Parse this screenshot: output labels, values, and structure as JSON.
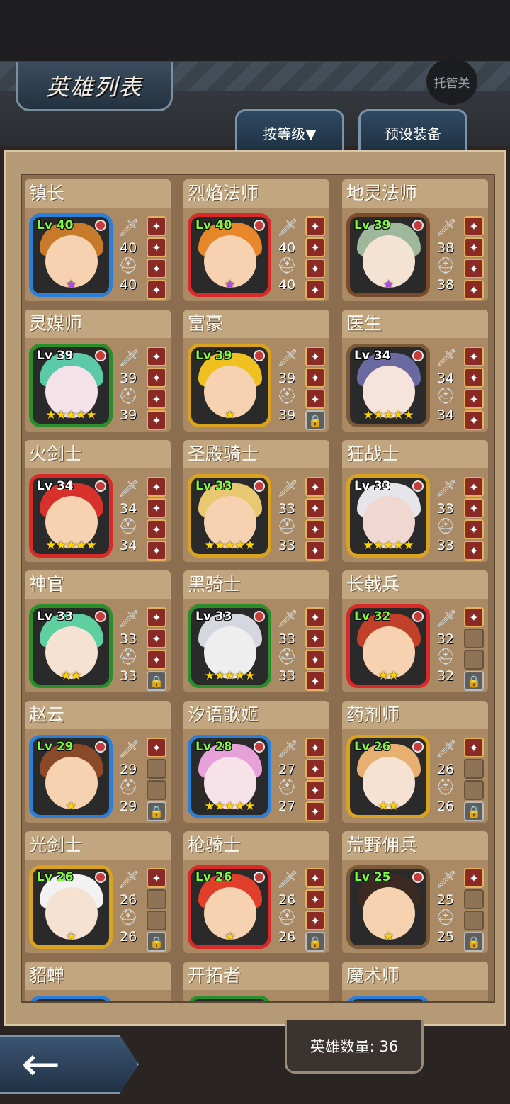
{
  "header": {
    "title": "英雄列表",
    "auto_label": "托管关"
  },
  "tabs": {
    "sort_label": "按等级▼",
    "preset_label": "预设装备"
  },
  "heroes": [
    {
      "name": "镇长",
      "level": "Lv 40",
      "atk": "40",
      "def": "40",
      "stars": 1,
      "star_color": "#c040ff",
      "frame": "#2c7fd8",
      "lvl_color": "#7cff3a",
      "hair": "#c77a2a",
      "face": "#f6d2b0",
      "slots": [
        "eq",
        "eq",
        "eq",
        "eq"
      ]
    },
    {
      "name": "烈焰法师",
      "level": "Lv 40",
      "atk": "40",
      "def": "40",
      "stars": 1,
      "star_color": "#c040ff",
      "frame": "#d92a2a",
      "lvl_color": "#7cff3a",
      "hair": "#e8862a",
      "face": "#f6d2b0",
      "slots": [
        "eq",
        "eq",
        "eq",
        "eq"
      ]
    },
    {
      "name": "地灵法师",
      "level": "Lv 39",
      "atk": "38",
      "def": "38",
      "stars": 1,
      "star_color": "#c040ff",
      "frame": "#7b4a2a",
      "lvl_color": "#7cff3a",
      "hair": "#9fb79a",
      "face": "#f4e2d2",
      "slots": [
        "eq",
        "eq",
        "eq",
        "eq"
      ]
    },
    {
      "name": "灵媒师",
      "level": "Lv 39",
      "atk": "39",
      "def": "39",
      "stars": 5,
      "star_color": "#ffd400",
      "frame": "#2a8f2a",
      "lvl_color": "#ffffff",
      "hair": "#5cc9a8",
      "face": "#f4e2e8",
      "slots": [
        "eq",
        "eq",
        "eq",
        "eq"
      ]
    },
    {
      "name": "富豪",
      "level": "Lv 39",
      "atk": "39",
      "def": "39",
      "stars": 1,
      "star_color": "#ffd400",
      "frame": "#d9a21f",
      "lvl_color": "#7cff3a",
      "hair": "#f0c020",
      "face": "#f6d2b0",
      "slots": [
        "eq",
        "eq",
        "eq",
        "lock"
      ]
    },
    {
      "name": "医生",
      "level": "Lv 34",
      "atk": "34",
      "def": "34",
      "stars": 5,
      "star_color": "#ffd400",
      "frame": "#7b5a3a",
      "lvl_color": "#ffffff",
      "hair": "#6a6aa0",
      "face": "#f6e4dc",
      "slots": [
        "eq",
        "eq",
        "eq",
        "eq"
      ]
    },
    {
      "name": "火剑士",
      "level": "Lv 34",
      "atk": "34",
      "def": "34",
      "stars": 5,
      "star_color": "#ffd400",
      "frame": "#d92a2a",
      "lvl_color": "#ffffff",
      "hair": "#d8302a",
      "face": "#f6d2b0",
      "slots": [
        "eq",
        "eq",
        "eq",
        "eq"
      ]
    },
    {
      "name": "圣殿骑士",
      "level": "Lv 33",
      "atk": "33",
      "def": "33",
      "stars": 5,
      "star_color": "#ffd400",
      "frame": "#d9a21f",
      "lvl_color": "#7cff3a",
      "hair": "#e8c870",
      "face": "#f6d2b0",
      "slots": [
        "eq",
        "eq",
        "eq",
        "eq"
      ]
    },
    {
      "name": "狂战士",
      "level": "Lv 33",
      "atk": "33",
      "def": "33",
      "stars": 5,
      "star_color": "#ffd400",
      "frame": "#d9a21f",
      "lvl_color": "#ffffff",
      "hair": "#e6e6ea",
      "face": "#f0d8d0",
      "slots": [
        "eq",
        "eq",
        "eq",
        "eq"
      ]
    },
    {
      "name": "神官",
      "level": "Lv 33",
      "atk": "33",
      "def": "33",
      "stars": 2,
      "star_color": "#ffd400",
      "frame": "#2a8f2a",
      "lvl_color": "#ffffff",
      "hair": "#5ecfa0",
      "face": "#f6e2d2",
      "slots": [
        "eq",
        "eq",
        "eq",
        "lock"
      ]
    },
    {
      "name": "黑骑士",
      "level": "Lv 33",
      "atk": "33",
      "def": "33",
      "stars": 5,
      "star_color": "#ffd400",
      "frame": "#2a8f2a",
      "lvl_color": "#ffffff",
      "hair": "#d6d6de",
      "face": "#eeeeee",
      "slots": [
        "eq",
        "eq",
        "eq",
        "eq"
      ]
    },
    {
      "name": "长戟兵",
      "level": "Lv 32",
      "atk": "32",
      "def": "32",
      "stars": 2,
      "star_color": "#ffd400",
      "frame": "#d92a2a",
      "lvl_color": "#7cff3a",
      "hair": "#c0402a",
      "face": "#f6d2b0",
      "slots": [
        "eq",
        "empty",
        "empty",
        "lock"
      ]
    },
    {
      "name": "赵云",
      "level": "Lv 29",
      "atk": "29",
      "def": "29",
      "stars": 1,
      "star_color": "#ffd400",
      "frame": "#2c7fd8",
      "lvl_color": "#7cff3a",
      "hair": "#8a4a2a",
      "face": "#f6d2b0",
      "slots": [
        "eq",
        "empty",
        "empty",
        "lock"
      ]
    },
    {
      "name": "汐语歌姬",
      "level": "Lv 28",
      "atk": "27",
      "def": "27",
      "stars": 5,
      "star_color": "#ffd400",
      "frame": "#2c7fd8",
      "lvl_color": "#7cff3a",
      "hair": "#e8a0d8",
      "face": "#f6e2e8",
      "slots": [
        "eq",
        "eq",
        "eq",
        "eq"
      ]
    },
    {
      "name": "药剂师",
      "level": "Lv 26",
      "atk": "26",
      "def": "26",
      "stars": 2,
      "star_color": "#ffd400",
      "frame": "#d9a21f",
      "lvl_color": "#7cff3a",
      "hair": "#e8b070",
      "face": "#f6e2d2",
      "slots": [
        "eq",
        "empty",
        "empty",
        "lock"
      ]
    },
    {
      "name": "光剑士",
      "level": "Lv 26",
      "atk": "26",
      "def": "26",
      "stars": 1,
      "star_color": "#ffd400",
      "frame": "#d9a21f",
      "lvl_color": "#7cff3a",
      "hair": "#f2f2f2",
      "face": "#f6e2d2",
      "slots": [
        "eq",
        "empty",
        "empty",
        "lock"
      ]
    },
    {
      "name": "枪骑士",
      "level": "Lv 26",
      "atk": "26",
      "def": "26",
      "stars": 1,
      "star_color": "#ffd400",
      "frame": "#d92a2a",
      "lvl_color": "#7cff3a",
      "hair": "#e0402a",
      "face": "#f6d2b0",
      "slots": [
        "eq",
        "eq",
        "eq",
        "lock"
      ]
    },
    {
      "name": "荒野佣兵",
      "level": "Lv 25",
      "atk": "25",
      "def": "25",
      "stars": 1,
      "star_color": "#ffd400",
      "frame": "#7b5a3a",
      "lvl_color": "#7cff3a",
      "hair": "#3a2a22",
      "face": "#f6d2b0",
      "slots": [
        "eq",
        "empty",
        "empty",
        "lock"
      ]
    },
    {
      "name": "貂蝉",
      "level": "",
      "atk": "",
      "def": "",
      "stars": 0,
      "star_color": "#ffd400",
      "frame": "#2c7fd8",
      "lvl_color": "#7cff3a",
      "hair": "#8a4a8a",
      "face": "#f6d2b0",
      "slots": []
    },
    {
      "name": "开拓者",
      "level": "",
      "atk": "",
      "def": "",
      "stars": 0,
      "star_color": "#ffd400",
      "frame": "#2a8f2a",
      "lvl_color": "#7cff3a",
      "hair": "#6a4a2a",
      "face": "#f6d2b0",
      "slots": []
    },
    {
      "name": "魔术师",
      "level": "",
      "atk": "",
      "def": "",
      "stars": 0,
      "star_color": "#ffd400",
      "frame": "#2c7fd8",
      "lvl_color": "#7cff3a",
      "hair": "#3a3a5a",
      "face": "#f6d2b0",
      "slots": []
    }
  ],
  "footer": {
    "hero_count_label": "英雄数量: 36"
  }
}
